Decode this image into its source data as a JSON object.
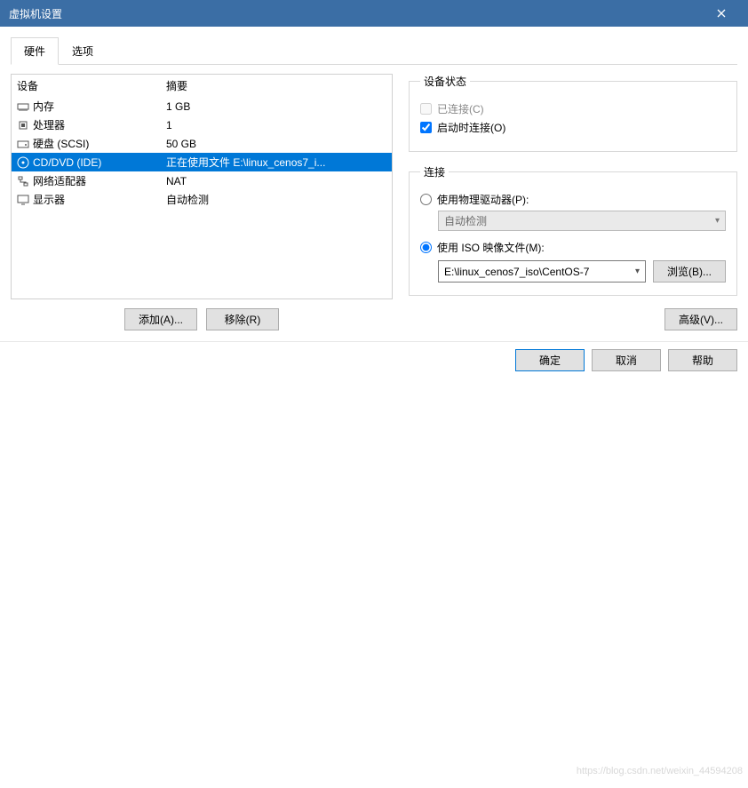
{
  "window": {
    "title": "虚拟机设置"
  },
  "tabs": {
    "hardware": "硬件",
    "options": "选项"
  },
  "deviceList": {
    "header": {
      "device": "设备",
      "summary": "摘要"
    },
    "rows": [
      {
        "name": "内存",
        "summary": "1 GB"
      },
      {
        "name": "处理器",
        "summary": "1"
      },
      {
        "name": "硬盘 (SCSI)",
        "summary": "50 GB"
      },
      {
        "name": "CD/DVD (IDE)",
        "summary": "正在使用文件 E:\\linux_cenos7_i..."
      },
      {
        "name": "网络适配器",
        "summary": "NAT"
      },
      {
        "name": "显示器",
        "summary": "自动检测"
      }
    ]
  },
  "leftButtons": {
    "add": "添加(A)...",
    "remove": "移除(R)"
  },
  "deviceStatus": {
    "legend": "设备状态",
    "connected": "已连接(C)",
    "connectAtPowerOn": "启动时连接(O)"
  },
  "connection": {
    "legend": "连接",
    "usePhysical": "使用物理驱动器(P):",
    "physicalValue": "自动检测",
    "useIso": "使用 ISO 映像文件(M):",
    "isoPath": "E:\\linux_cenos7_iso\\CentOS-7",
    "browse": "浏览(B)..."
  },
  "advanced": "高级(V)...",
  "footer": {
    "ok": "确定",
    "cancel": "取消",
    "help": "帮助"
  },
  "watermark": "https://blog.csdn.net/weixin_44594208"
}
